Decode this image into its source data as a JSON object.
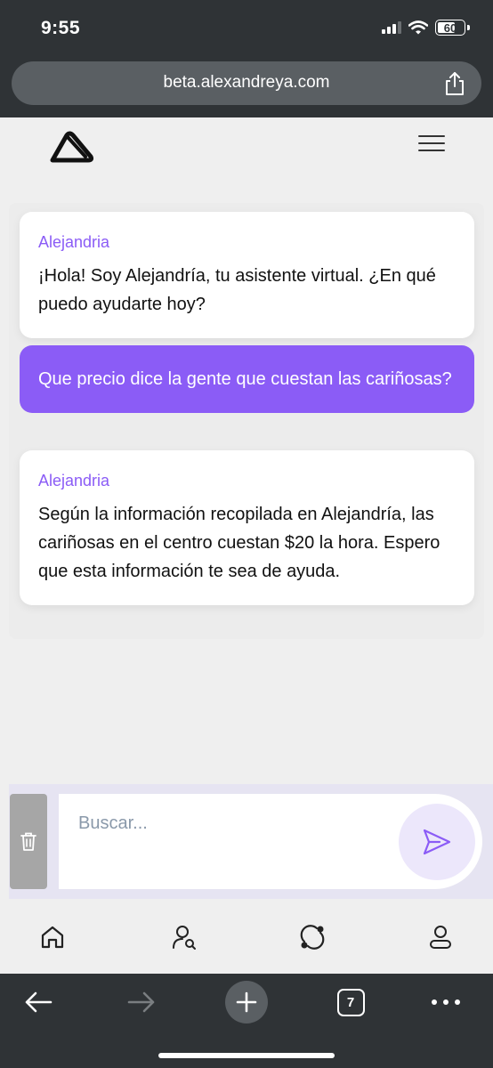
{
  "status_bar": {
    "time": "9:55",
    "battery": "60"
  },
  "browser": {
    "url": "beta.alexandreya.com",
    "tab_count": "7"
  },
  "chat": {
    "messages": [
      {
        "role": "bot",
        "author": "Alejandria",
        "text": "¡Hola! Soy Alejandría, tu asistente virtual. ¿En qué puedo ayudarte hoy?"
      },
      {
        "role": "user",
        "text": "Que precio dice la gente que cuestan las cariñosas?"
      },
      {
        "role": "bot",
        "author": "Alejandria",
        "text": "Según la información recopilada en Alejandría, las cariñosas en el centro cuestan $20 la hora. Espero que esta información te sea de ayuda."
      }
    ]
  },
  "input": {
    "placeholder": "Buscar..."
  },
  "icons": {
    "logo": "triangle-logo-icon",
    "menu": "hamburger-menu-icon",
    "trash": "trash-icon",
    "send": "send-icon",
    "nav": [
      "home-icon",
      "user-search-icon",
      "refresh-icon",
      "profile-icon"
    ]
  },
  "colors": {
    "accent": "#8b5cf6",
    "browser_chrome": "#2f3336",
    "page_background": "#efefef"
  }
}
